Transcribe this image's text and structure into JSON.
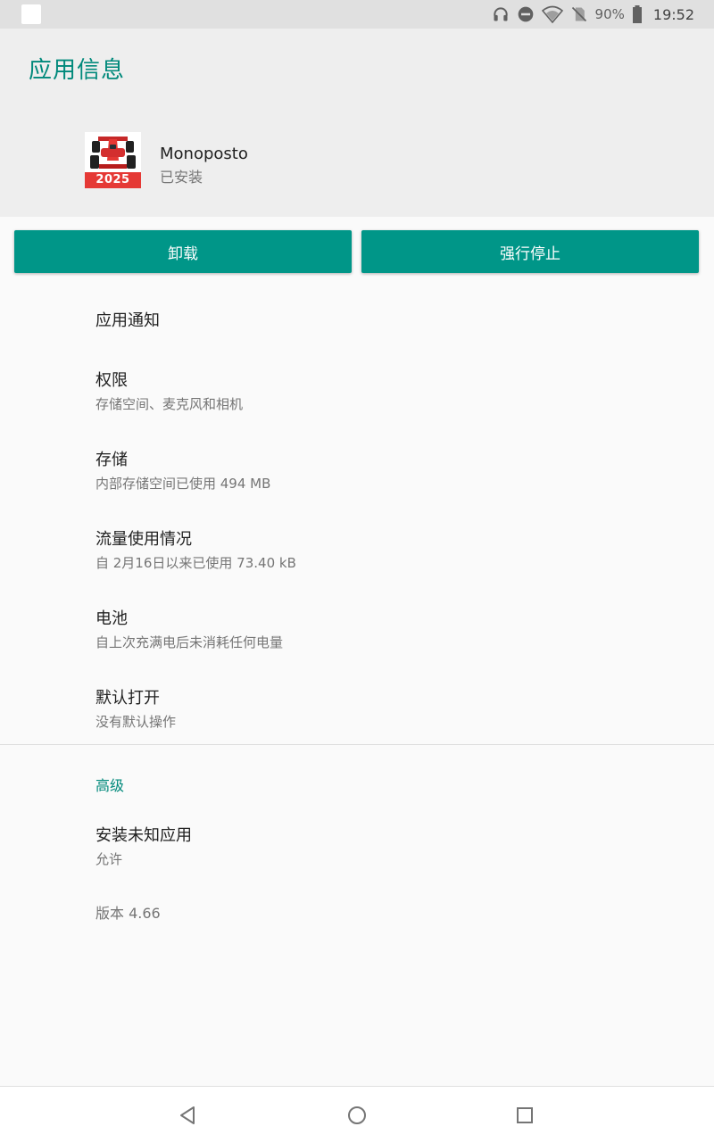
{
  "status_bar": {
    "battery_percent": "90%",
    "time": "19:52",
    "icons": [
      "headphones-icon",
      "do-not-disturb-icon",
      "wifi-icon",
      "no-sim-icon",
      "battery-icon"
    ]
  },
  "header": {
    "title": "应用信息",
    "app_name": "Monoposto",
    "app_status": "已安装",
    "app_icon_text": "2025"
  },
  "buttons": {
    "uninstall": "卸载",
    "force_stop": "强行停止"
  },
  "settings": [
    {
      "title": "应用通知",
      "subtitle": ""
    },
    {
      "title": "权限",
      "subtitle": "存储空间、麦克风和相机"
    },
    {
      "title": "存储",
      "subtitle": "内部存储空间已使用 494 MB"
    },
    {
      "title": "流量使用情况",
      "subtitle": "自 2月16日以来已使用 73.40 kB"
    },
    {
      "title": "电池",
      "subtitle": "自上次充满电后未消耗任何电量"
    },
    {
      "title": "默认打开",
      "subtitle": "没有默认操作"
    }
  ],
  "advanced": {
    "label": "高级",
    "items": [
      {
        "title": "安装未知应用",
        "subtitle": "允许"
      }
    ]
  },
  "version": "版本 4.66",
  "colors": {
    "accent": "#00897b",
    "button": "#009688",
    "header_bg": "#eeeeee",
    "status_bar_bg": "#e0e0e0"
  },
  "nav_bar": {
    "icons": [
      "back-icon",
      "home-icon",
      "recents-icon"
    ]
  }
}
